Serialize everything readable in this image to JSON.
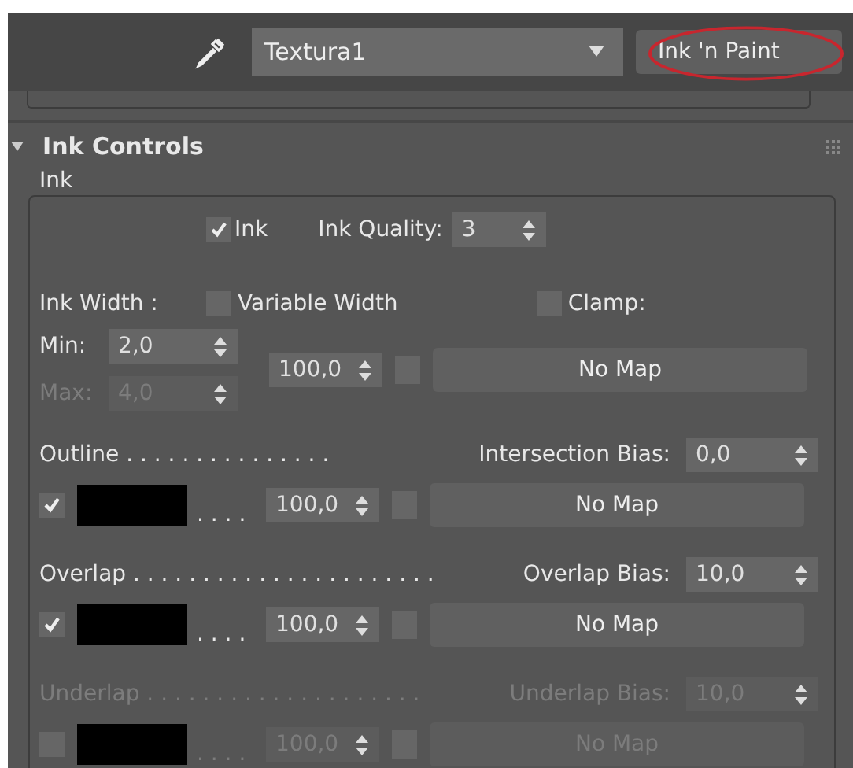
{
  "toolbar": {
    "material": "Textura1",
    "type_button": {
      "label": "Ink 'n Paint",
      "circled": true
    }
  },
  "rollout": {
    "title": "Ink Controls",
    "expanded": true,
    "group": {
      "title": "Ink",
      "ink": {
        "label": "Ink",
        "checked": true
      },
      "quality": {
        "label": "Ink Quality:",
        "value": "3"
      },
      "width": {
        "label": "Ink Width :",
        "variable": {
          "label": "Variable Width",
          "checked": false
        },
        "clamp": {
          "label": "Clamp:",
          "checked": false
        },
        "min": {
          "label": "Min:",
          "value": "2,0",
          "disabled": false
        },
        "max": {
          "label": "Max:",
          "value": "4,0",
          "disabled": true
        },
        "amount": "100,0",
        "map_checked": false,
        "map": "No Map"
      },
      "sections": [
        {
          "label": "Outline . . . . . . . . . . . . . . .",
          "bias_label": "Intersection Bias:",
          "bias": "0,0",
          "disabled": false,
          "checked": true,
          "color": "#000000",
          "dots": ". . . .",
          "amount": "100,0",
          "map_checked": false,
          "map": "No Map"
        },
        {
          "label": "Overlap . . . . . . . . . . . . . . . . . . . . . .",
          "bias_label": "Overlap Bias:",
          "bias": "10,0",
          "disabled": false,
          "checked": true,
          "color": "#000000",
          "dots": ". . . .",
          "amount": "100,0",
          "map_checked": false,
          "map": "No Map"
        },
        {
          "label": "Underlap . . . . . . . . . . . . . . . . . . . .",
          "bias_label": "Underlap Bias:",
          "bias": "10,0",
          "disabled": true,
          "checked": false,
          "color": "#000000",
          "dots": ". . . .",
          "amount": "100,0",
          "map_checked": false,
          "map": "No Map"
        }
      ]
    }
  }
}
